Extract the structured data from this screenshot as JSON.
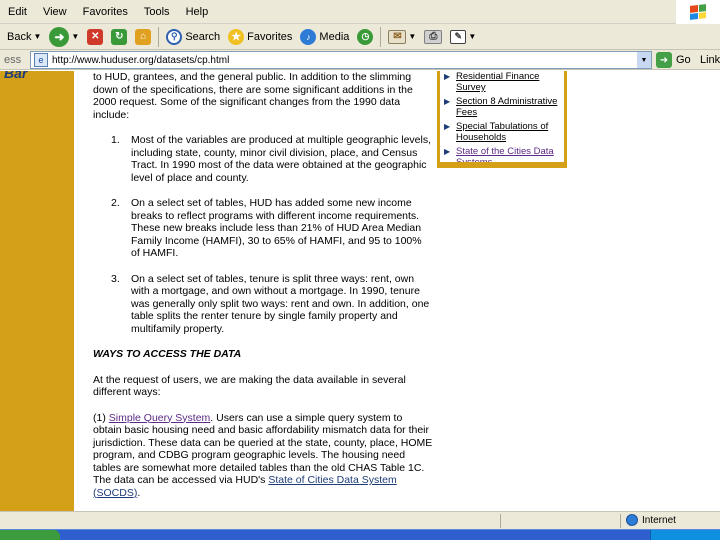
{
  "menu": {
    "items": [
      "Edit",
      "View",
      "Favorites",
      "Tools",
      "Help"
    ]
  },
  "toolbar": {
    "back_label": "Back",
    "search_label": "Search",
    "favorites_label": "Favorites",
    "media_label": "Media"
  },
  "address": {
    "label": "ess",
    "url": "http://www.huduser.org/datasets/cp.html",
    "go_label": "Go",
    "links_label": "Links"
  },
  "content": {
    "intro": "to HUD, grantees, and the general public. In addition to the slimming down of the specifications, there are some significant additions in the 2000 request. Some of the significant changes from the 1990 data include:",
    "list": [
      {
        "num": "1.",
        "text": "Most of the variables are produced at multiple geographic levels, including state, county, minor civil division, place, and Census Tract. In 1990 most of the data were obtained at the geographic level of place and county."
      },
      {
        "num": "2.",
        "text": "On a select set of tables, HUD has added some new income breaks to reflect programs with different income requirements. These new breaks include less than 21% of HUD Area Median Family Income (HAMFI), 30 to 65% of HAMFI, and 95 to 100% of HAMFI."
      },
      {
        "num": "3.",
        "text": "On a select set of tables, tenure is split three ways: rent, own with a mortgage, and own without a mortgage. In 1990, tenure was generally only split two ways: rent and own. In addition, one table splits the renter tenure by single family property and multifamily property."
      }
    ],
    "section_head": "WAYS TO ACCESS THE DATA",
    "access_intro": "At the request of users, we are making the data available in several different ways:",
    "sqs_prefix": "(1)",
    "sqs_link": "Simple Query System",
    "sqs_text": ". Users can use a simple query system to obtain basic housing need and basic affordability mismatch data for their jurisdiction. These data can be queried at the state, county, place, HOME program, and CDBG program geographic levels. The housing need tables are somewhat more detailed tables than the old CHAS Table 1C. The data can be accessed via HUD's ",
    "socds_link": "State of Cities Data System (SOCDS)",
    "socds_suffix": "."
  },
  "sidebar": {
    "items": [
      {
        "label": "Residential Finance Survey",
        "visited": false
      },
      {
        "label": "Section 8 Administrative Fees",
        "visited": false
      },
      {
        "label": "Special Tabulations of Households",
        "visited": false
      },
      {
        "label": "State of the Cities Data Systems",
        "visited": true
      }
    ]
  },
  "status": {
    "zone_label": "Internet"
  },
  "colors": {
    "gold": "#d4a017",
    "link_visited": "#5b2a86",
    "chrome": "#ece9d8"
  }
}
